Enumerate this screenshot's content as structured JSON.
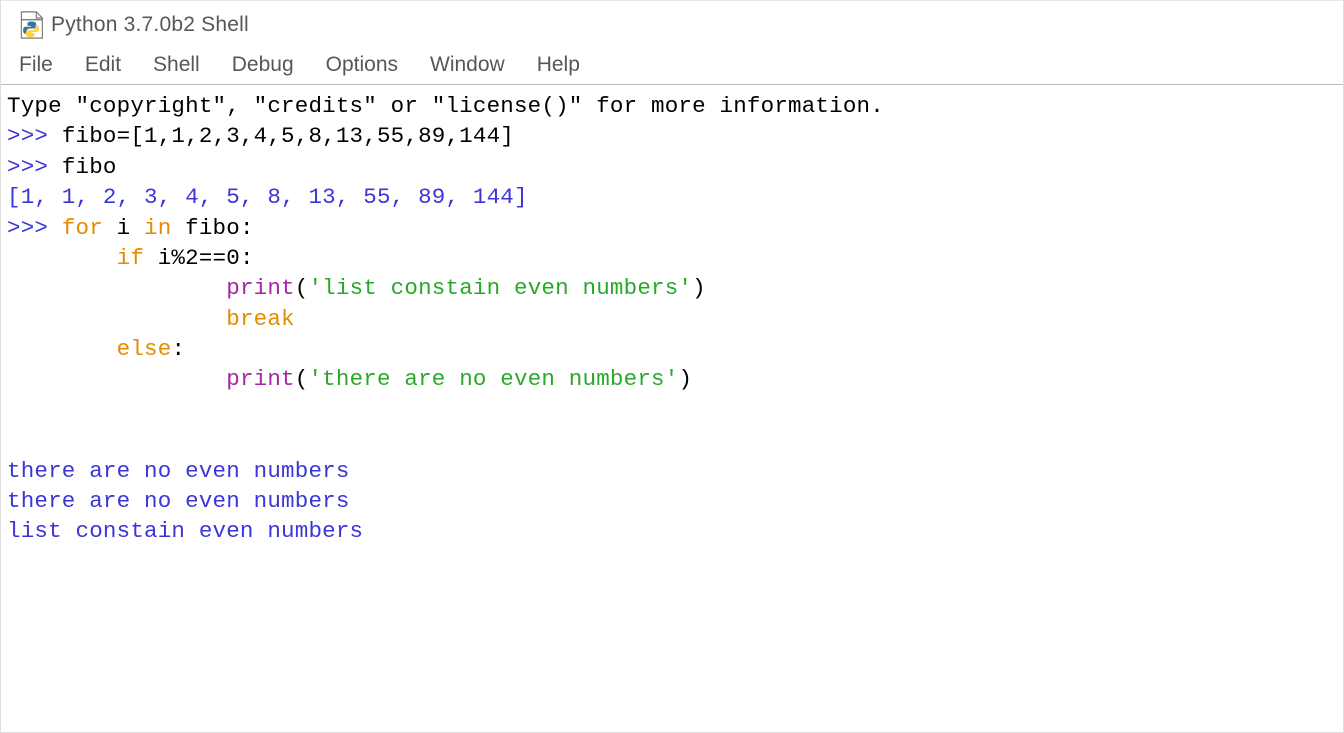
{
  "title": "Python 3.7.0b2 Shell",
  "menu": {
    "file": "File",
    "edit": "Edit",
    "shell": "Shell",
    "debug": "Debug",
    "options": "Options",
    "window": "Window",
    "help": "Help"
  },
  "shell": {
    "info": "Type \"copyright\", \"credits\" or \"license()\" for more information.",
    "prompt": ">>> ",
    "line1_code": "fibo=[1,1,2,3,4,5,8,13,55,89,144]",
    "line2_code": "fibo",
    "repr": "[1, 1, 2, 3, 4, 5, 8, 13, 55, 89, 144]",
    "kw_for": "for",
    "for_mid": " i ",
    "kw_in": "in",
    "for_tail": " fibo:",
    "indent1": "        ",
    "kw_if": "if",
    "if_tail": " i%2==0:",
    "indent2": "                ",
    "bi_print": "print",
    "paren_open": "(",
    "paren_close": ")",
    "str1": "'list constain even numbers'",
    "kw_break": "break",
    "kw_else": "else",
    "colon": ":",
    "str2": "'there are no even numbers'",
    "out1": "there are no even numbers",
    "out2": "there are no even numbers",
    "out3": "list constain even numbers"
  }
}
